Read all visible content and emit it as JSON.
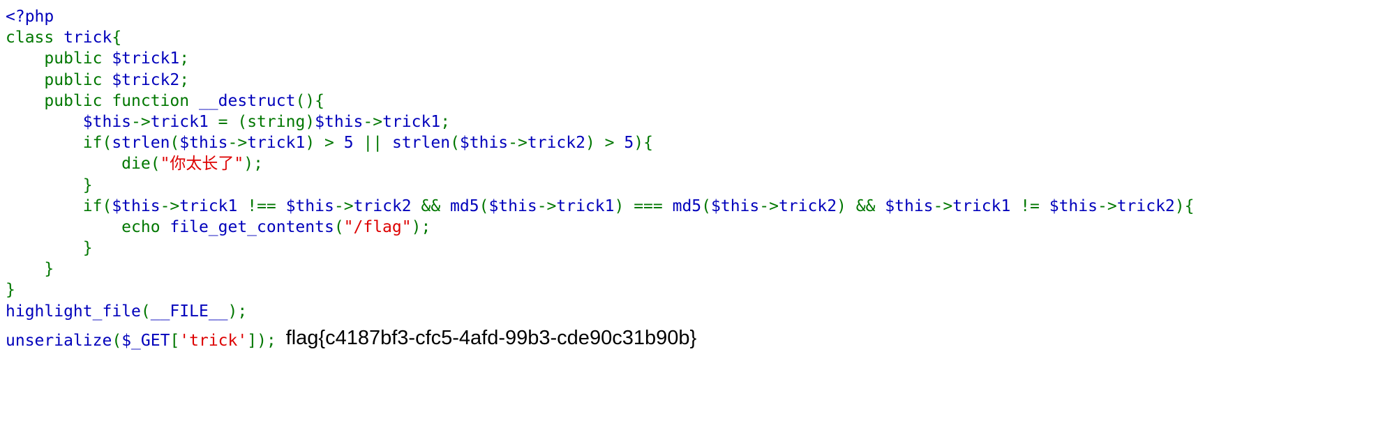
{
  "code_lines": [
    [
      {
        "t": "<?php",
        "c": "default"
      }
    ],
    [
      {
        "t": "class ",
        "c": "keyword"
      },
      {
        "t": "trick",
        "c": "default"
      },
      {
        "t": "{",
        "c": "keyword"
      }
    ],
    [
      {
        "t": "    public ",
        "c": "keyword"
      },
      {
        "t": "$trick1",
        "c": "default"
      },
      {
        "t": ";",
        "c": "keyword"
      }
    ],
    [
      {
        "t": "    public ",
        "c": "keyword"
      },
      {
        "t": "$trick2",
        "c": "default"
      },
      {
        "t": ";",
        "c": "keyword"
      }
    ],
    [
      {
        "t": "    public function ",
        "c": "keyword"
      },
      {
        "t": "__destruct",
        "c": "default"
      },
      {
        "t": "(){",
        "c": "keyword"
      }
    ],
    [
      {
        "t": "        ",
        "c": "keyword"
      },
      {
        "t": "$this",
        "c": "default"
      },
      {
        "t": "->",
        "c": "keyword"
      },
      {
        "t": "trick1 ",
        "c": "default"
      },
      {
        "t": "= (string)",
        "c": "keyword"
      },
      {
        "t": "$this",
        "c": "default"
      },
      {
        "t": "->",
        "c": "keyword"
      },
      {
        "t": "trick1",
        "c": "default"
      },
      {
        "t": ";",
        "c": "keyword"
      }
    ],
    [
      {
        "t": "        if(",
        "c": "keyword"
      },
      {
        "t": "strlen",
        "c": "default"
      },
      {
        "t": "(",
        "c": "keyword"
      },
      {
        "t": "$this",
        "c": "default"
      },
      {
        "t": "->",
        "c": "keyword"
      },
      {
        "t": "trick1",
        "c": "default"
      },
      {
        "t": ") > ",
        "c": "keyword"
      },
      {
        "t": "5 ",
        "c": "default"
      },
      {
        "t": "|| ",
        "c": "keyword"
      },
      {
        "t": "strlen",
        "c": "default"
      },
      {
        "t": "(",
        "c": "keyword"
      },
      {
        "t": "$this",
        "c": "default"
      },
      {
        "t": "->",
        "c": "keyword"
      },
      {
        "t": "trick2",
        "c": "default"
      },
      {
        "t": ") > ",
        "c": "keyword"
      },
      {
        "t": "5",
        "c": "default"
      },
      {
        "t": "){",
        "c": "keyword"
      }
    ],
    [
      {
        "t": "            die(",
        "c": "keyword"
      },
      {
        "t": "\"你太长了\"",
        "c": "string"
      },
      {
        "t": ");",
        "c": "keyword"
      }
    ],
    [
      {
        "t": "        }",
        "c": "keyword"
      }
    ],
    [
      {
        "t": "        if(",
        "c": "keyword"
      },
      {
        "t": "$this",
        "c": "default"
      },
      {
        "t": "->",
        "c": "keyword"
      },
      {
        "t": "trick1 ",
        "c": "default"
      },
      {
        "t": "!== ",
        "c": "keyword"
      },
      {
        "t": "$this",
        "c": "default"
      },
      {
        "t": "->",
        "c": "keyword"
      },
      {
        "t": "trick2 ",
        "c": "default"
      },
      {
        "t": "&& ",
        "c": "keyword"
      },
      {
        "t": "md5",
        "c": "default"
      },
      {
        "t": "(",
        "c": "keyword"
      },
      {
        "t": "$this",
        "c": "default"
      },
      {
        "t": "->",
        "c": "keyword"
      },
      {
        "t": "trick1",
        "c": "default"
      },
      {
        "t": ") === ",
        "c": "keyword"
      },
      {
        "t": "md5",
        "c": "default"
      },
      {
        "t": "(",
        "c": "keyword"
      },
      {
        "t": "$this",
        "c": "default"
      },
      {
        "t": "->",
        "c": "keyword"
      },
      {
        "t": "trick2",
        "c": "default"
      },
      {
        "t": ") && ",
        "c": "keyword"
      },
      {
        "t": "$this",
        "c": "default"
      },
      {
        "t": "->",
        "c": "keyword"
      },
      {
        "t": "trick1 ",
        "c": "default"
      },
      {
        "t": "!= ",
        "c": "keyword"
      },
      {
        "t": "$this",
        "c": "default"
      },
      {
        "t": "->",
        "c": "keyword"
      },
      {
        "t": "trick2",
        "c": "default"
      },
      {
        "t": "){",
        "c": "keyword"
      }
    ],
    [
      {
        "t": "            echo ",
        "c": "keyword"
      },
      {
        "t": "file_get_contents",
        "c": "default"
      },
      {
        "t": "(",
        "c": "keyword"
      },
      {
        "t": "\"/flag\"",
        "c": "string"
      },
      {
        "t": ");",
        "c": "keyword"
      }
    ],
    [
      {
        "t": "        }",
        "c": "keyword"
      }
    ],
    [
      {
        "t": "    }",
        "c": "keyword"
      }
    ],
    [
      {
        "t": "}",
        "c": "keyword"
      }
    ],
    [
      {
        "t": "highlight_file",
        "c": "default"
      },
      {
        "t": "(",
        "c": "keyword"
      },
      {
        "t": "__FILE__",
        "c": "default"
      },
      {
        "t": ");",
        "c": "keyword"
      }
    ],
    [
      {
        "t": "unserialize",
        "c": "default"
      },
      {
        "t": "(",
        "c": "keyword"
      },
      {
        "t": "$_GET",
        "c": "default"
      },
      {
        "t": "[",
        "c": "keyword"
      },
      {
        "t": "'trick'",
        "c": "string"
      },
      {
        "t": "]);",
        "c": "keyword"
      }
    ]
  ],
  "output_text": "flag{c4187bf3-cfc5-4afd-99b3-cde90c31b90b}",
  "colors": {
    "default": "#0000BB",
    "keyword": "#007700",
    "string": "#DD0000",
    "output": "#000000"
  }
}
